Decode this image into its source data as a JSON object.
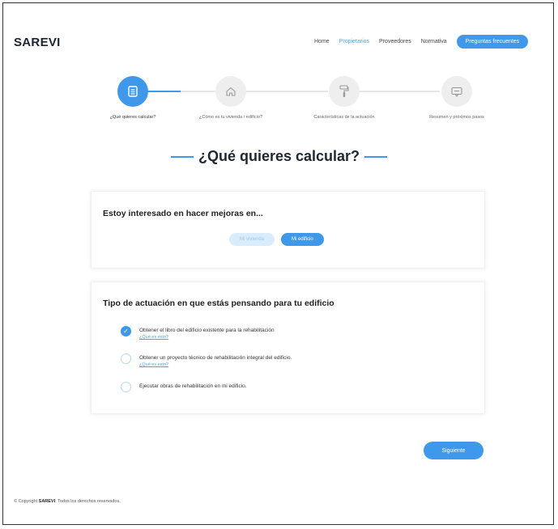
{
  "brand": "SAREVI",
  "nav": {
    "items": [
      "Home",
      "Propietarios",
      "Proveedores",
      "Normativa"
    ],
    "active_index": 1,
    "cta": "Preguntas frecuentes"
  },
  "stepper": {
    "steps": [
      {
        "label": "¿Qué quieres calcular?",
        "icon": "document-icon"
      },
      {
        "label": "¿Cómo es tu vivienda / edificio?",
        "icon": "house-icon"
      },
      {
        "label": "Características de la actuación",
        "icon": "paint-roller-icon"
      },
      {
        "label": "Resumen y próximos pasos",
        "icon": "chat-icon"
      }
    ],
    "active_index": 0
  },
  "section_title": "¿Qué quieres calcular?",
  "card1": {
    "title": "Estoy interesado en hacer mejoras en...",
    "options": [
      "Mi vivienda",
      "Mi edificio"
    ],
    "selected_index": 1
  },
  "card2": {
    "title": "Tipo de actuación en que estás pensando para tu edificio",
    "options": [
      {
        "text": "Obtener el libro del edificio existente para la rehabilitación",
        "more": "¿Qué es esto?",
        "checked": true
      },
      {
        "text": "Obtener un proyecto técnico de rehabilitación integral del edificio.",
        "more": "¿Qué es esto?",
        "checked": false
      },
      {
        "text": "Ejecutar obras de rehabilitación en mi edificio.",
        "more": "",
        "checked": false
      }
    ]
  },
  "next_button": "Siguiente",
  "footer": {
    "prefix": "© Copyright",
    "brand": "SAREVI",
    "suffix": ". Todos los derechos reservados."
  },
  "colors": {
    "accent": "#3f98ea",
    "accent_light": "#d9ecfb",
    "text": "#1e2733"
  }
}
